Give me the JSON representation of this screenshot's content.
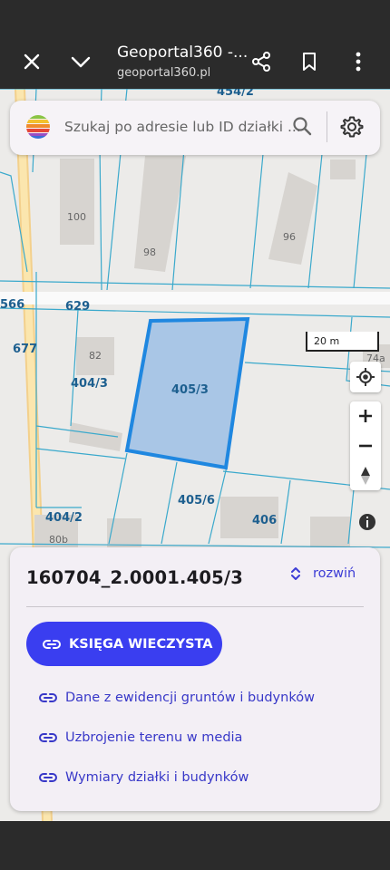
{
  "browser": {
    "page_title": "Geoportal360 -...",
    "url": "geoportal360.pl"
  },
  "search": {
    "placeholder": "Szukaj po adresie lub ID działki ..."
  },
  "map": {
    "plot_labels": {
      "p454_2": "454/2",
      "p566": "566",
      "p629": "629",
      "p677": "677",
      "p404_3": "404/3",
      "p405_3": "405/3",
      "p405_6": "405/6",
      "p404_2": "404/2",
      "p406": "406"
    },
    "house_numbers": {
      "h100": "100",
      "h98": "98",
      "h96": "96",
      "h82": "82",
      "h80b": "80b",
      "h74a": "74a"
    },
    "scale_label": "20 m",
    "selected_fill": "#a9c6e6",
    "selected_stroke": "#1f87e0"
  },
  "panel": {
    "plot_id": "160704_2.0001.405/3",
    "expand_label": "rozwiń",
    "primary_button": "KSIĘGA WIECZYSTA",
    "links": [
      "Dane z ewidencji gruntów i budynków",
      "Uzbrojenie terenu w media",
      "Wymiary działki i budynków"
    ],
    "accent_color": "#3a3ef0"
  }
}
